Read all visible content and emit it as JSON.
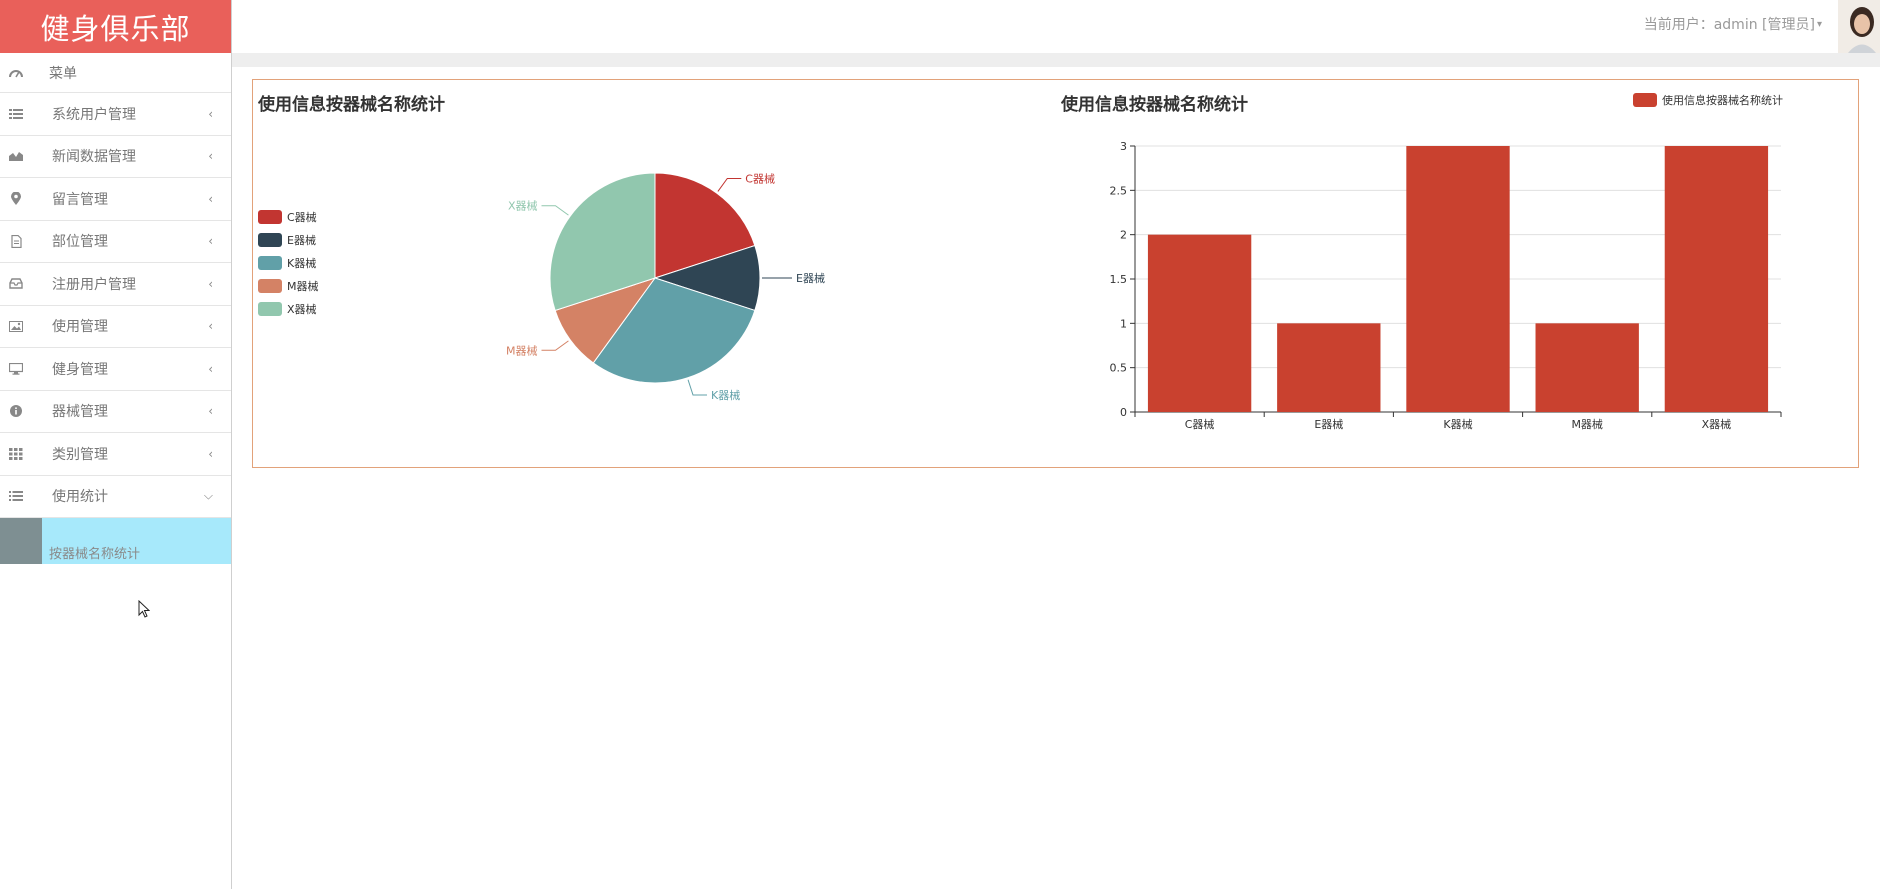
{
  "brand": "健身俱乐部",
  "menu": {
    "header": {
      "label": "菜单",
      "icon": "dashboard-icon"
    },
    "items": [
      {
        "label": "系统用户管理",
        "icon": "list-icon"
      },
      {
        "label": "新闻数据管理",
        "icon": "area-chart-icon"
      },
      {
        "label": "留言管理",
        "icon": "map-marker-icon"
      },
      {
        "label": "部位管理",
        "icon": "file-icon"
      },
      {
        "label": "注册用户管理",
        "icon": "inbox-icon"
      },
      {
        "label": "使用管理",
        "icon": "image-icon"
      },
      {
        "label": "健身管理",
        "icon": "desktop-icon"
      },
      {
        "label": "器械管理",
        "icon": "info-circle-icon"
      },
      {
        "label": "类别管理",
        "icon": "grid-icon"
      },
      {
        "label": "使用统计",
        "icon": "list-ul-icon",
        "expanded": true
      }
    ],
    "submenu_item": "按器械名称统计"
  },
  "header": {
    "user_label": "当前用户：admin [管理员]",
    "avatar": "avatar-icon"
  },
  "colors": {
    "brand": "#e9605a",
    "active_submenu": "#a7e9fb",
    "series": [
      "#c23531",
      "#2f4554",
      "#61a0a8",
      "#d48265",
      "#91c7ae"
    ],
    "bar": "#c9412f"
  },
  "chart_data": [
    {
      "type": "pie",
      "title": "使用信息按器械名称统计",
      "categories": [
        "C器械",
        "E器械",
        "K器械",
        "M器械",
        "X器械"
      ],
      "values": [
        2,
        1,
        3,
        1,
        3
      ],
      "legend": "left"
    },
    {
      "type": "bar",
      "title": "使用信息按器械名称统计",
      "categories": [
        "C器械",
        "E器械",
        "K器械",
        "M器械",
        "X器械"
      ],
      "series": [
        {
          "name": "使用信息按器械名称统计",
          "values": [
            2,
            1,
            3,
            1,
            3
          ]
        }
      ],
      "ylim": [
        0,
        3
      ],
      "yticks": [
        "0",
        "0.5",
        "1",
        "1.5",
        "2",
        "2.5",
        "3"
      ],
      "legend": "top",
      "grid": true
    }
  ]
}
